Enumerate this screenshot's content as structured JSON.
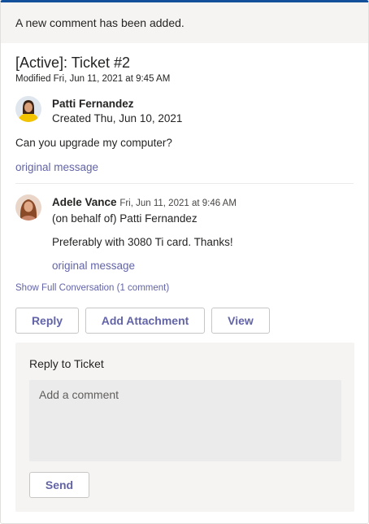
{
  "notification": {
    "text": "A new comment has been added."
  },
  "ticket": {
    "title": "[Active]: Ticket #2",
    "modified": "Modified Fri, Jun 11, 2021 at 9:45 AM"
  },
  "original_post": {
    "author": "Patti Fernandez",
    "created": "Created Thu, Jun 10, 2021",
    "message": "Can you upgrade my computer?",
    "link_label": "original message"
  },
  "comment": {
    "author": "Adele Vance",
    "timestamp": "Fri, Jun 11, 2021 at 9:46 AM",
    "on_behalf": "(on behalf of) Patti Fernandez",
    "message": "Preferably with 3080 Ti card. Thanks!",
    "link_label": "original message"
  },
  "conversation_link": "Show Full Conversation (1 comment)",
  "actions": {
    "reply": "Reply",
    "add_attachment": "Add Attachment",
    "view": "View"
  },
  "reply_form": {
    "title": "Reply to Ticket",
    "placeholder": "Add a comment",
    "send": "Send"
  },
  "colors": {
    "accent": "#6264a7",
    "top_border": "#12509b",
    "panel_bg": "#f5f4f3"
  }
}
